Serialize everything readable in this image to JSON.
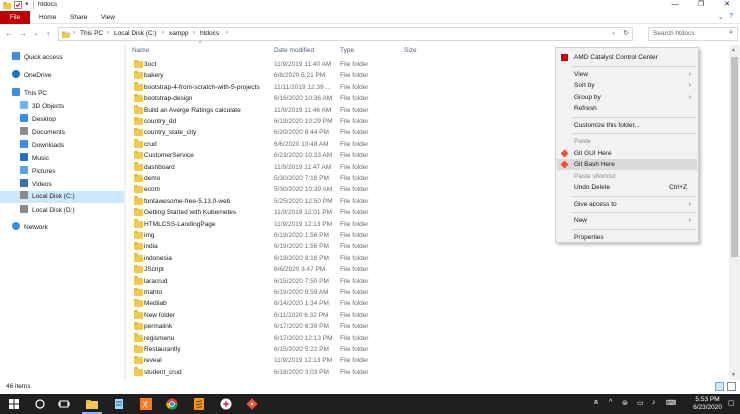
{
  "window": {
    "title": "htdocs"
  },
  "ribbon": {
    "tabs": [
      "File",
      "Home",
      "Share",
      "View"
    ]
  },
  "address": {
    "crumbs": [
      "This PC",
      "Local Disk (C:)",
      "xampp",
      "htdocs"
    ]
  },
  "search": {
    "placeholder": "Search htdocs"
  },
  "nav": {
    "items": [
      {
        "label": "Quick access",
        "icon": "star-icon"
      },
      {
        "label": "OneDrive",
        "icon": "cloud-icon"
      },
      {
        "label": "This PC",
        "icon": "computer-icon"
      },
      {
        "label": "3D Objects",
        "icon": "cube-icon"
      },
      {
        "label": "Desktop",
        "icon": "desktop-icon"
      },
      {
        "label": "Documents",
        "icon": "documents-icon"
      },
      {
        "label": "Downloads",
        "icon": "download-icon"
      },
      {
        "label": "Music",
        "icon": "music-icon"
      },
      {
        "label": "Pictures",
        "icon": "pictures-icon"
      },
      {
        "label": "Videos",
        "icon": "videos-icon"
      },
      {
        "label": "Local Disk (C:)",
        "icon": "drive-icon"
      },
      {
        "label": "Local Disk (D:)",
        "icon": "drive-icon"
      },
      {
        "label": "Network",
        "icon": "network-icon"
      }
    ],
    "selected": "Local Disk (C:)"
  },
  "columns": {
    "name": "Name",
    "date": "Date modified",
    "type": "Type",
    "size": "Size"
  },
  "files": [
    {
      "name": "3oct",
      "date": "11/9/2019 11:40 AM",
      "type": "File folder"
    },
    {
      "name": "bakery",
      "date": "6/8/2020 5:21 PM",
      "type": "File folder"
    },
    {
      "name": "bootstrap-4-from-scratch-with-5-projects",
      "date": "11/11/2019 12:39 ...",
      "type": "File folder"
    },
    {
      "name": "bootstrap-design",
      "date": "6/16/2020 10:36 AM",
      "type": "File folder"
    },
    {
      "name": "Build an Averge Ratings calculate",
      "date": "11/9/2019 11:46 AM",
      "type": "File folder"
    },
    {
      "name": "country_dd",
      "date": "6/19/2020 10:29 PM",
      "type": "File folder"
    },
    {
      "name": "country_state_city",
      "date": "6/20/2020 8:44 PM",
      "type": "File folder"
    },
    {
      "name": "crud",
      "date": "6/6/2020 10:48 AM",
      "type": "File folder"
    },
    {
      "name": "CustomerService",
      "date": "6/23/2020 10:33 AM",
      "type": "File folder"
    },
    {
      "name": "dashboard",
      "date": "11/9/2019 11:47 AM",
      "type": "File folder"
    },
    {
      "name": "demo",
      "date": "5/30/2020 7:18 PM",
      "type": "File folder"
    },
    {
      "name": "ecom",
      "date": "5/30/2020 10:39 AM",
      "type": "File folder"
    },
    {
      "name": "fontawesome-free-5.13.0-web",
      "date": "5/25/2020 12:50 PM",
      "type": "File folder"
    },
    {
      "name": "Getting Started with Kubernetes",
      "date": "11/9/2019 12:01 PM",
      "type": "File folder"
    },
    {
      "name": "HTMLCSS-LandingPage",
      "date": "11/9/2019 12:13 PM",
      "type": "File folder"
    },
    {
      "name": "img",
      "date": "6/19/2020 1:56 PM",
      "type": "File folder"
    },
    {
      "name": "india",
      "date": "6/19/2020 1:56 PM",
      "type": "File folder"
    },
    {
      "name": "indonesia",
      "date": "6/19/2020 8:18 PM",
      "type": "File folder"
    },
    {
      "name": "JScript",
      "date": "6/6/2020 3:47 PM",
      "type": "File folder"
    },
    {
      "name": "laracrud",
      "date": "6/15/2020 7:50 PM",
      "type": "File folder"
    },
    {
      "name": "mahto",
      "date": "6/19/2020 9:59 AM",
      "type": "File folder"
    },
    {
      "name": "Medilab",
      "date": "6/14/2020 1:34 PM",
      "type": "File folder"
    },
    {
      "name": "New folder",
      "date": "6/11/2020 6:32 PM",
      "type": "File folder"
    },
    {
      "name": "permalink",
      "date": "6/17/2020 6:39 PM",
      "type": "File folder"
    },
    {
      "name": "regismenu",
      "date": "6/17/2020 12:13 PM",
      "type": "File folder"
    },
    {
      "name": "Restaurantly",
      "date": "6/15/2020 5:22 PM",
      "type": "File folder"
    },
    {
      "name": "reveal",
      "date": "11/9/2019 12:13 PM",
      "type": "File folder"
    },
    {
      "name": "student_crud",
      "date": "6/18/2020 3:03 PM",
      "type": "File folder"
    }
  ],
  "context_menu": {
    "items": [
      {
        "label": "AMD Catalyst Control Center",
        "icon": "amd-icon"
      },
      {
        "sep": true
      },
      {
        "label": "View",
        "submenu": true
      },
      {
        "label": "Sort by",
        "submenu": true
      },
      {
        "label": "Group by",
        "submenu": true
      },
      {
        "label": "Refresh"
      },
      {
        "sep": true
      },
      {
        "label": "Customize this folder..."
      },
      {
        "sep": true
      },
      {
        "label": "Paste",
        "disabled": true
      },
      {
        "label": "Git GUI Here",
        "icon": "git-gui-icon"
      },
      {
        "label": "Git Bash Here",
        "icon": "git-bash-icon",
        "hover": true
      },
      {
        "label": "Paste shortcut",
        "disabled": true
      },
      {
        "label": "Undo Delete",
        "shortcut": "Ctrl+Z"
      },
      {
        "sep": true
      },
      {
        "label": "Give access to",
        "submenu": true
      },
      {
        "sep": true
      },
      {
        "label": "New",
        "submenu": true
      },
      {
        "sep": true
      },
      {
        "label": "Properties"
      }
    ]
  },
  "status": {
    "count": "46 items"
  },
  "taskbar": {
    "time": "5:53 PM",
    "date": "6/23/2020"
  }
}
